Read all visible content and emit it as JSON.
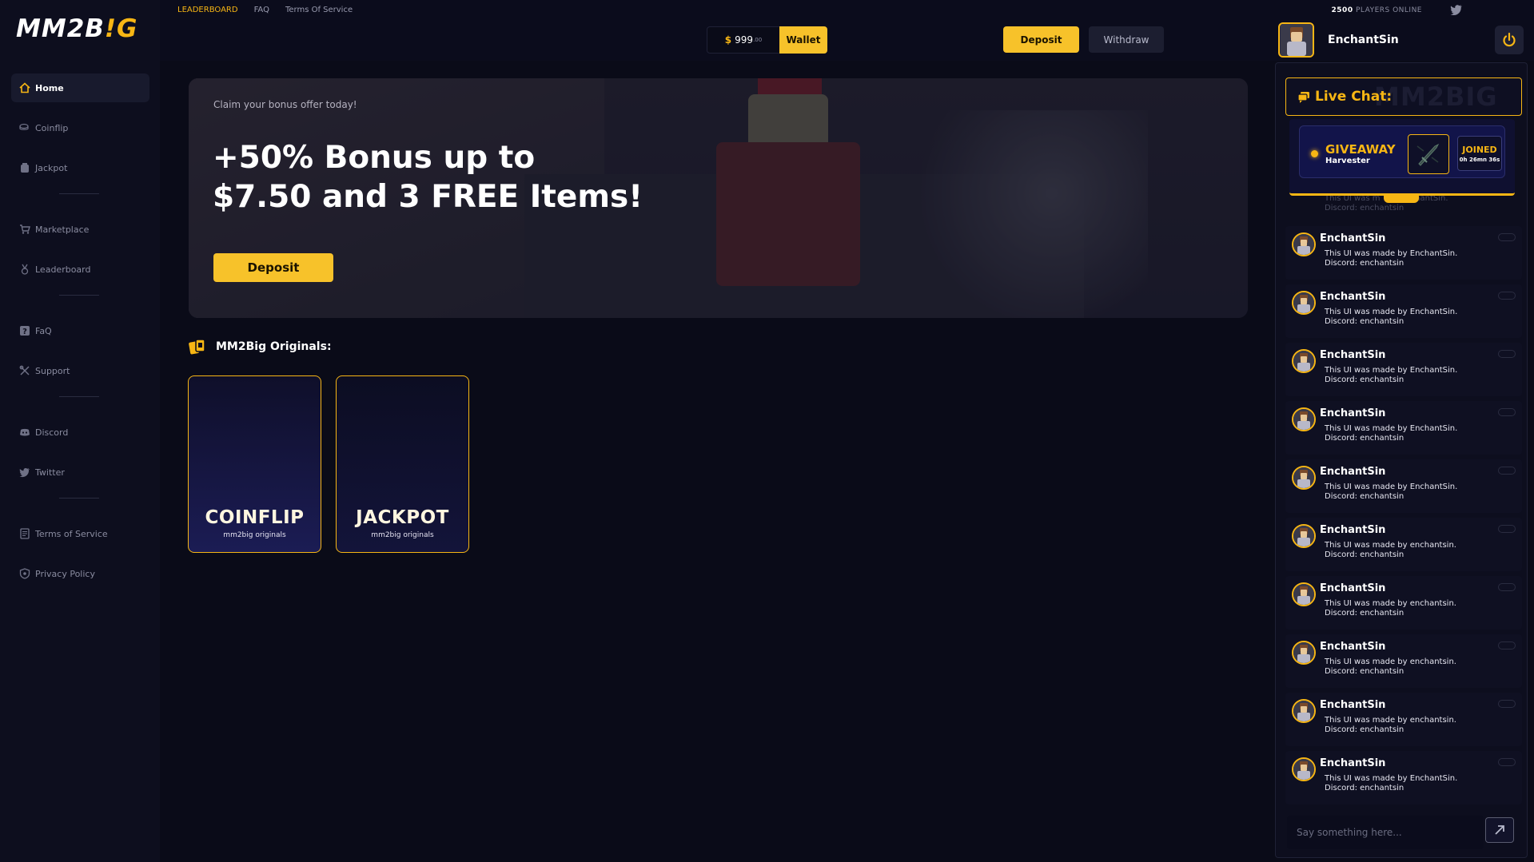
{
  "brand": {
    "logo_main": "MM2B",
    "logo_accent": "!G",
    "accent_color": "#f7b614"
  },
  "top_links": [
    {
      "label": "LEADERBOARD",
      "active": true
    },
    {
      "label": "FAQ",
      "active": false
    },
    {
      "label": "Terms Of Service",
      "active": false
    }
  ],
  "players_online": {
    "count": "2500",
    "label": "PLAYERS ONLINE"
  },
  "wallet": {
    "currency": "$",
    "amount": "999",
    "cents": ".00",
    "button": "Wallet"
  },
  "actions": {
    "deposit": "Deposit",
    "withdraw": "Withdraw"
  },
  "user": {
    "name": "EnchantSin"
  },
  "sidebar": {
    "items": [
      {
        "label": "Home",
        "icon": "home-icon",
        "active": true
      },
      {
        "label": "Coinflip",
        "icon": "coinflip-icon",
        "active": false
      },
      {
        "label": "Jackpot",
        "icon": "jackpot-icon",
        "active": false
      },
      {
        "label": "Marketplace",
        "icon": "cart-icon",
        "active": false
      },
      {
        "label": "Leaderboard",
        "icon": "medal-icon",
        "active": false
      },
      {
        "label": "FaQ",
        "icon": "question-icon",
        "active": false
      },
      {
        "label": "Support",
        "icon": "tools-icon",
        "active": false
      },
      {
        "label": "Discord",
        "icon": "discord-icon",
        "active": false
      },
      {
        "label": "Twitter",
        "icon": "twitter-icon",
        "active": false
      },
      {
        "label": "Terms of Service",
        "icon": "document-icon",
        "active": false
      },
      {
        "label": "Privacy Policy",
        "icon": "shield-icon",
        "active": false
      }
    ]
  },
  "banner": {
    "claim": "Claim your bonus offer today!",
    "headline_line1": "+50% Bonus up to",
    "headline_line2": "$7.50 and 3 FREE Items!",
    "cta": "Deposit"
  },
  "originals": {
    "title": "MM2Big Originals:",
    "games": [
      {
        "name": "COINFLIP",
        "sub": "mm2big originals"
      },
      {
        "name": "JACKPOT",
        "sub": "mm2big originals"
      }
    ]
  },
  "chat": {
    "title": "Live Chat:",
    "watermark": "MM2BIG",
    "giveaway": {
      "title": "GIVEAWAY",
      "item": "Harvester",
      "status": "JOINED",
      "timer": "0h 26mn 36s"
    },
    "peek_line1": "This UI was m",
    "peek_line1_end": "chantSin.",
    "peek_line2": "Discord: enchantsin",
    "messages": [
      {
        "user": "EnchantSin",
        "line1": "This UI was made by EnchantSin.",
        "line2": "Discord: enchantsin"
      },
      {
        "user": "EnchantSin",
        "line1": "This UI was made by EnchantSin.",
        "line2": "Discord: enchantsin"
      },
      {
        "user": "EnchantSin",
        "line1": "This UI was made by EnchantSin.",
        "line2": "Discord: enchantsin"
      },
      {
        "user": "EnchantSin",
        "line1": "This UI was made by EnchantSin.",
        "line2": "Discord: enchantsin"
      },
      {
        "user": "EnchantSin",
        "line1": "This UI was made by EnchantSin.",
        "line2": "Discord: enchantsin"
      },
      {
        "user": "EnchantSin",
        "line1": "This UI was made by enchantsin.",
        "line2": "Discord: enchantsin"
      },
      {
        "user": "EnchantSin",
        "line1": "This UI was made by enchantsin.",
        "line2": "Discord: enchantsin"
      },
      {
        "user": "EnchantSin",
        "line1": "This UI was made by enchantsin.",
        "line2": "Discord: enchantsin"
      },
      {
        "user": "EnchantSin",
        "line1": "This UI was made by enchantsin.",
        "line2": "Discord: enchantsin"
      },
      {
        "user": "EnchantSin",
        "line1": "This UI was made by EnchantSin.",
        "line2": "Discord: enchantsin"
      }
    ],
    "input_placeholder": "Say something here..."
  }
}
